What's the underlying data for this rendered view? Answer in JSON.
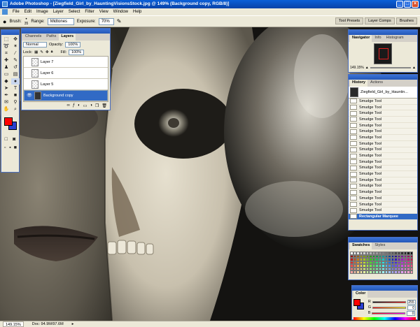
{
  "window": {
    "title": "Adobe Photoshop - [Ziegfield_Girl_by_HauntingVisionsStock.jpg @ 149% (Background copy, RGB/8)]",
    "minimize": "_",
    "maximize": "□",
    "close": "×"
  },
  "menu": [
    "File",
    "Edit",
    "Image",
    "Layer",
    "Select",
    "Filter",
    "View",
    "Window",
    "Help"
  ],
  "options_bar": {
    "brush_label": "Brush:",
    "brush_size": "35",
    "range_label": "Range:",
    "range_value": "Midtones",
    "exposure_label": "Exposure:",
    "exposure_value": "70%",
    "wells": [
      "Tool Presets",
      "Layer Comps",
      "Brushes"
    ]
  },
  "layers_panel": {
    "tabs": [
      "Channels",
      "Paths",
      "Layers"
    ],
    "blend_mode": "Normal",
    "opacity_label": "Opacity:",
    "opacity": "100%",
    "lock_label": "Lock:",
    "fill_label": "Fill:",
    "fill": "100%",
    "layers": [
      {
        "name": "Layer 7",
        "visible": false,
        "selected": false
      },
      {
        "name": "Layer 6",
        "visible": false,
        "selected": false
      },
      {
        "name": "Layer 5",
        "visible": false,
        "selected": false
      },
      {
        "name": "Background copy",
        "visible": true,
        "selected": true
      }
    ]
  },
  "navigator_panel": {
    "tabs": [
      "Navigator",
      "Info",
      "Histogram"
    ],
    "zoom": "149.15%"
  },
  "history_panel": {
    "tabs": [
      "History",
      "Actions"
    ],
    "snapshot": "Ziegfield_Girl_by_Hauntin...",
    "items": [
      "Smudge Tool",
      "Smudge Tool",
      "Smudge Tool",
      "Smudge Tool",
      "Smudge Tool",
      "Smudge Tool",
      "Smudge Tool",
      "Smudge Tool",
      "Smudge Tool",
      "Smudge Tool",
      "Smudge Tool",
      "Smudge Tool",
      "Smudge Tool",
      "Smudge Tool",
      "Smudge Tool",
      "Smudge Tool",
      "Smudge Tool",
      "Smudge Tool",
      "Smudge Tool"
    ],
    "current": "Rectangular Marquee"
  },
  "swatches_panel": {
    "tabs": [
      "Swatches",
      "Styles"
    ]
  },
  "color_panel": {
    "tabs": [
      "Color"
    ],
    "channels": [
      {
        "label": "R",
        "value": "255",
        "color": "#ff2a2a"
      },
      {
        "label": "G",
        "value": "0",
        "color": "#2aa82a"
      },
      {
        "label": "B",
        "value": "0",
        "color": "#2a5cff"
      }
    ]
  },
  "status": {
    "zoom": "149.15%",
    "doc": "Doc: 94.9M/97.6M"
  },
  "colors": {
    "foreground": "#ff0000",
    "background": "#2b3fd0",
    "accent": "#316ac5"
  }
}
